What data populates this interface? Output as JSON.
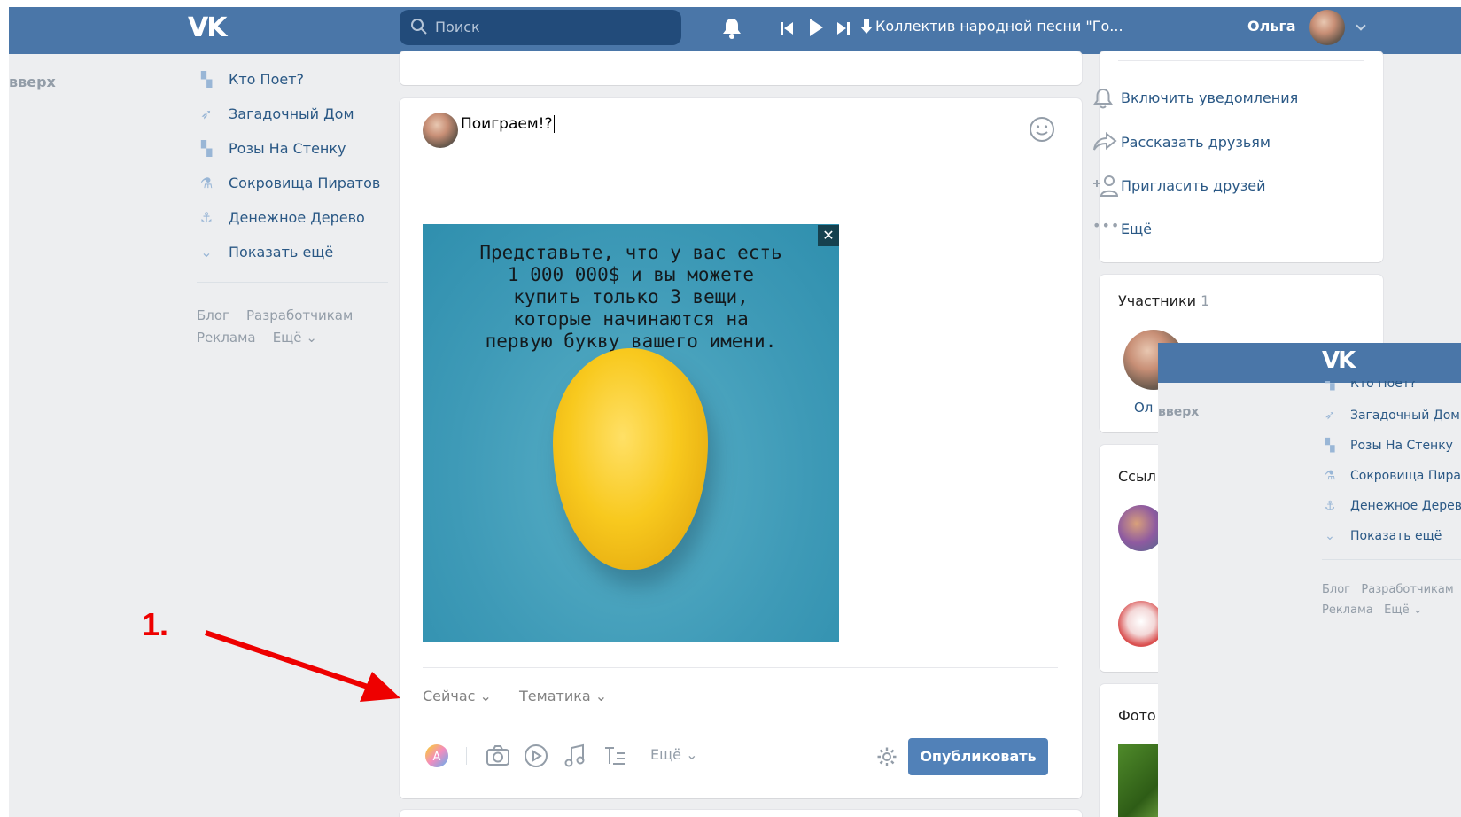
{
  "header": {
    "logo": "VK",
    "search_placeholder": "Поиск",
    "track": "Коллектив народной песни \"Го...",
    "user_name": "Ольга"
  },
  "left_nav": {
    "to_top": "вверх",
    "items": [
      {
        "label": "Кто Поет?",
        "icon": "apps-icon"
      },
      {
        "label": "Загадочный Дом",
        "icon": "rocket-icon"
      },
      {
        "label": "Розы На Стенку",
        "icon": "apps-icon"
      },
      {
        "label": "Сокровища Пиратов",
        "icon": "flask-icon"
      },
      {
        "label": "Денежное Дерево",
        "icon": "anchor-icon"
      },
      {
        "label": "Показать ещё",
        "icon": "chevron-down-icon"
      }
    ],
    "footer": {
      "blog": "Блог",
      "dev": "Разработчикам",
      "ads": "Реклама",
      "more": "Ещё"
    }
  },
  "composer": {
    "text": "Поиграем!?",
    "image_text_lines": [
      "Представьте, что у вас есть",
      "1 000 000$ и вы можете",
      "купить только 3 вещи,",
      "которые начинаются на",
      "первую букву вашего имени."
    ],
    "close": "✕",
    "time_option": "Сейчас",
    "topic_option": "Тематика",
    "more_label": "Ещё",
    "publish_label": "Опубликовать"
  },
  "annotation": {
    "label": "1.",
    "color": "#ee0000"
  },
  "right_menu": {
    "items": [
      {
        "label": "Включить уведомления",
        "icon": "bell-icon"
      },
      {
        "label": "Рассказать друзьям",
        "icon": "share-icon"
      },
      {
        "label": "Пригласить друзей",
        "icon": "add-user-icon"
      },
      {
        "label": "Ещё",
        "icon": "more-icon"
      }
    ]
  },
  "members": {
    "title": "Участники",
    "count": "1",
    "member_name_fragment": "Ол"
  },
  "links": {
    "title_fragment": "Ссыл"
  },
  "photos": {
    "title_fragment": "Фото"
  },
  "overlay": {
    "logo": "VK",
    "to_top": "вверх",
    "items": [
      {
        "label": "Кто Поет?",
        "icon": "apps-icon"
      },
      {
        "label": "Загадочный Дом",
        "icon": "rocket-icon"
      },
      {
        "label": "Розы На Стенку",
        "icon": "apps-icon"
      },
      {
        "label": "Сокровища Пиратов",
        "icon": "flask-icon"
      },
      {
        "label": "Денежное Дерево",
        "icon": "anchor-icon"
      },
      {
        "label": "Показать ещё",
        "icon": "chevron-down-icon"
      }
    ],
    "footer": {
      "blog": "Блог",
      "dev": "Разработчикам",
      "ads": "Реклама",
      "more": "Ещё"
    }
  },
  "colors": {
    "header": "#4a76a8",
    "link": "#2a5885",
    "button": "#5181b8",
    "background": "#edeef0"
  }
}
